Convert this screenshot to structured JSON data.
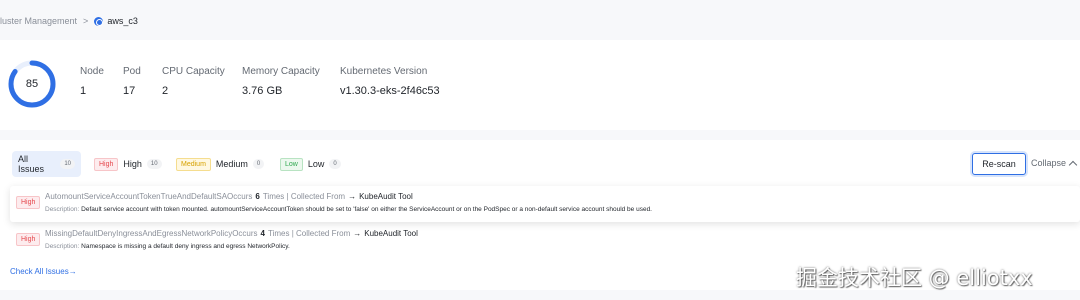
{
  "breadcrumb": {
    "parent": "luster Management",
    "separator": ">",
    "current": "aws_c3"
  },
  "summary": {
    "score": "85",
    "score_fraction": 0.85,
    "stats": [
      {
        "label": "Node",
        "value": "1"
      },
      {
        "label": "Pod",
        "value": "17"
      },
      {
        "label": "CPU Capacity",
        "value": "2"
      },
      {
        "label": "Memory Capacity",
        "value": "3.76 GB"
      },
      {
        "label": "Kubernetes Version",
        "value": "v1.30.3-eks-2f46c53"
      }
    ]
  },
  "tabs": {
    "all": {
      "label": "All Issues",
      "count": "10"
    },
    "high": {
      "badge": "High",
      "label": "High",
      "count": "10"
    },
    "medium": {
      "badge": "Medium",
      "label": "Medium",
      "count": "0"
    },
    "low": {
      "badge": "Low",
      "label": "Low",
      "count": "0"
    }
  },
  "rescan_label": "Re-scan",
  "collapse_label": "Collapse",
  "issues": [
    {
      "severity": "High",
      "name": "AutomountServiceAccountTokenTrueAndDefaultSAOccurs",
      "times": "6",
      "times_suffix": "Times | Collected From",
      "tool": "KubeAudit Tool",
      "desc_label": "Description:",
      "desc": "Default service account with token mounted. automountServiceAccountToken should be set to 'false' on either the ServiceAccount or on the PodSpec or a non-default service account should be used."
    },
    {
      "severity": "High",
      "name": "MissingDefaultDenyIngressAndEgressNetworkPolicyOccurs",
      "times": "4",
      "times_suffix": "Times | Collected From",
      "tool": "KubeAudit Tool",
      "desc_label": "Description:",
      "desc": "Namespace is missing a default deny ingress and egress NetworkPolicy."
    }
  ],
  "check_all_label": "Check All Issues",
  "watermark": "掘金技术社区 @ elliotxx",
  "colors": {
    "accent": "#2f6fe4",
    "high": "#e5484d",
    "medium": "#d6a100",
    "low": "#2fa84f"
  }
}
